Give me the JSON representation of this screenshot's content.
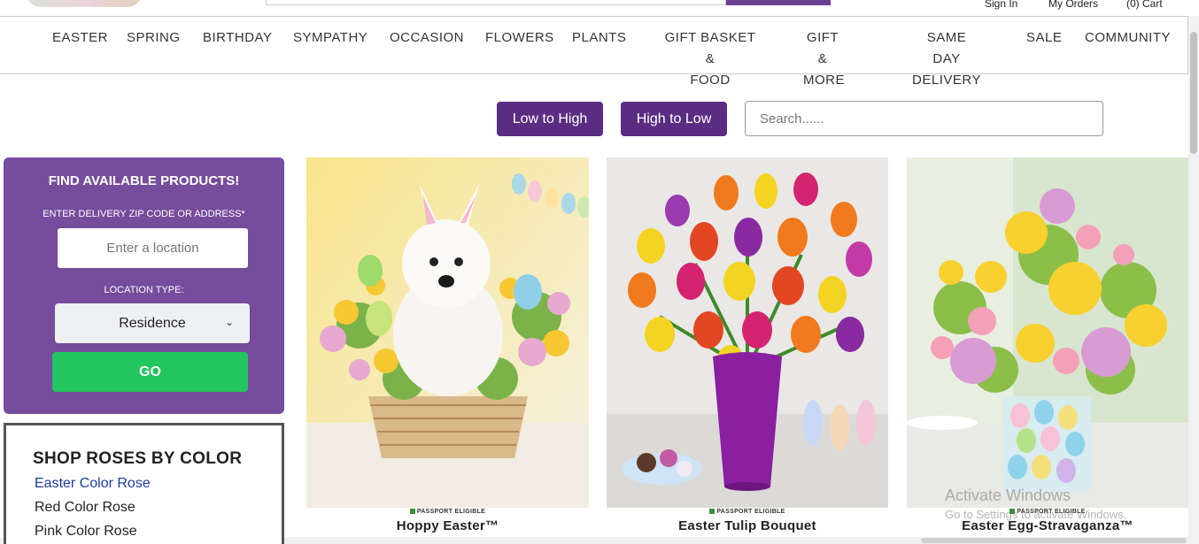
{
  "header": {
    "utility_links": {
      "sign_in": "Sign In",
      "my_orders": "My Orders",
      "cart": "(0) Cart"
    }
  },
  "nav": {
    "items": [
      {
        "label": "EASTER"
      },
      {
        "label": "SPRING"
      },
      {
        "label": "BIRTHDAY"
      },
      {
        "label": "SYMPATHY"
      },
      {
        "label": "OCCASION"
      },
      {
        "label": "FLOWERS"
      },
      {
        "label": "PLANTS"
      },
      {
        "label": "GIFT BASKET &\nFOOD"
      },
      {
        "label": "GIFT &\nMORE"
      },
      {
        "label": "SAME DAY\nDELIVERY"
      },
      {
        "label": "SALE"
      },
      {
        "label": "COMMUNITY"
      }
    ]
  },
  "sort": {
    "low_to_high": "Low to High",
    "high_to_low": "High to Low",
    "search_placeholder": "Search......"
  },
  "finder": {
    "title": "FIND AVAILABLE PRODUCTS!",
    "zip_label": "ENTER DELIVERY ZIP CODE OR ADDRESS*",
    "location_placeholder": "Enter a location",
    "location_type_label": "LOCATION TYPE:",
    "location_type_value": "Residence",
    "go_label": "GO"
  },
  "roses": {
    "title": "SHOP ROSES BY COLOR",
    "links": [
      "Easter Color Rose",
      "Red Color Rose",
      "Pink Color Rose"
    ]
  },
  "products": [
    {
      "name": "Hoppy Easter™",
      "badge": "PASSPORT ELIGIBLE"
    },
    {
      "name": "Easter Tulip Bouquet",
      "badge": "PASSPORT ELIGIBLE"
    },
    {
      "name": "Easter Egg-Stravaganza™",
      "badge": "PASSPORT ELIGIBLE"
    }
  ],
  "watermark": {
    "line1": "Activate Windows",
    "line2": "Go to Settings to activate Windows."
  },
  "colors": {
    "brand_purple": "#5b2d82",
    "finder_purple": "#764c9c",
    "go_green": "#22c55e",
    "active_link": "#1a3aa0"
  }
}
